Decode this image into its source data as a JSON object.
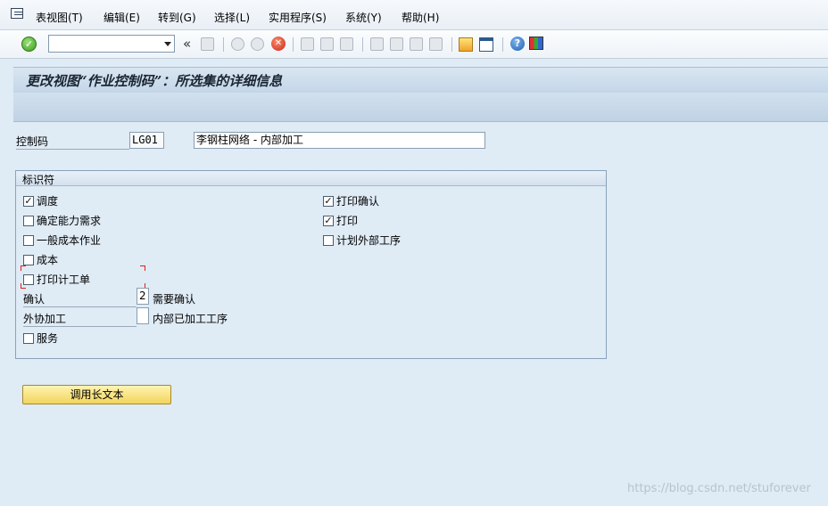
{
  "menubar": {
    "icon": "menu-icon",
    "items": [
      "表视图(T)",
      "编辑(E)",
      "转到(G)",
      "选择(L)",
      "实用程序(S)",
      "系统(Y)",
      "帮助(H)"
    ]
  },
  "toolbar": {
    "command_value": "",
    "icons": [
      "confirm-icon",
      "save-icon",
      "back-icon",
      "exit-icon",
      "cancel-icon",
      "print-icon",
      "find-icon",
      "find-next-icon",
      "first-page-icon",
      "previous-page-icon",
      "next-page-icon",
      "last-page-icon",
      "create-session-icon",
      "shortcut-icon",
      "help-icon",
      "customize-layout-icon"
    ]
  },
  "page": {
    "title": "更改视图“作业控制码”：所选集的详细信息"
  },
  "header": {
    "control_code_label": "控制码",
    "control_code_value": "LG01",
    "description_value": "李钢柱网络 - 内部加工"
  },
  "indicators": {
    "title": "标识符",
    "left": [
      {
        "label": "调度",
        "checked": true
      },
      {
        "label": "确定能力需求",
        "checked": false
      },
      {
        "label": "一般成本作业",
        "checked": false
      },
      {
        "label": "成本",
        "checked": false
      },
      {
        "label": "打印计工单",
        "checked": false
      }
    ],
    "right": [
      {
        "label": "打印确认",
        "checked": true
      },
      {
        "label": "打印",
        "checked": true
      },
      {
        "label": "计划外部工序",
        "checked": false
      }
    ],
    "confirm_label": "确认",
    "confirm_value": "2",
    "confirm_text": "需要确认",
    "external_label": "外协加工",
    "external_value": "",
    "external_text": "内部已加工工序",
    "service": {
      "label": "服务",
      "checked": false
    }
  },
  "buttons": {
    "long_text": "调用长文本"
  },
  "watermark": "https://blog.csdn.net/stuforever"
}
